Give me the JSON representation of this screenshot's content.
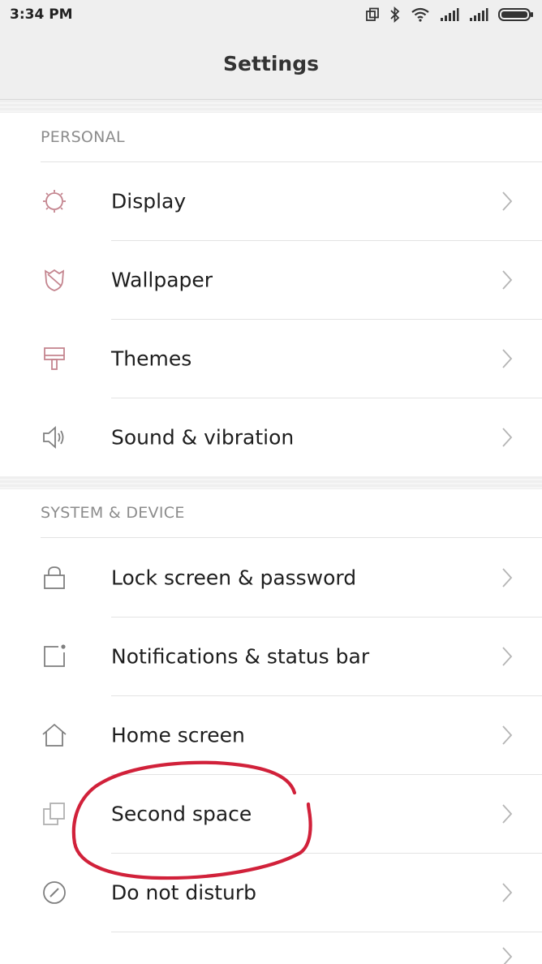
{
  "status_bar": {
    "time": "3:34 PM",
    "icons": [
      "second-space-icon",
      "bluetooth-icon",
      "wifi-icon",
      "signal-icon",
      "signal-icon",
      "battery-icon"
    ]
  },
  "header": {
    "title": "Settings"
  },
  "sections": [
    {
      "header": "PERSONAL",
      "items": [
        {
          "label": "Display",
          "icon": "display-icon"
        },
        {
          "label": "Wallpaper",
          "icon": "wallpaper-icon"
        },
        {
          "label": "Themes",
          "icon": "themes-icon"
        },
        {
          "label": "Sound & vibration",
          "icon": "sound-icon"
        }
      ]
    },
    {
      "header": "SYSTEM & DEVICE",
      "items": [
        {
          "label": "Lock screen & password",
          "icon": "lock-icon"
        },
        {
          "label": "Notifications & status bar",
          "icon": "notifications-icon"
        },
        {
          "label": "Home screen",
          "icon": "home-icon"
        },
        {
          "label": "Second space",
          "icon": "second-space-icon"
        },
        {
          "label": "Do not disturb",
          "icon": "do-not-disturb-icon"
        }
      ]
    }
  ],
  "colors": {
    "bar_background": "#efefef",
    "icon_personal": "#c4858f",
    "icon_system": "#7f7f7f",
    "annotation": "#d1213a"
  }
}
